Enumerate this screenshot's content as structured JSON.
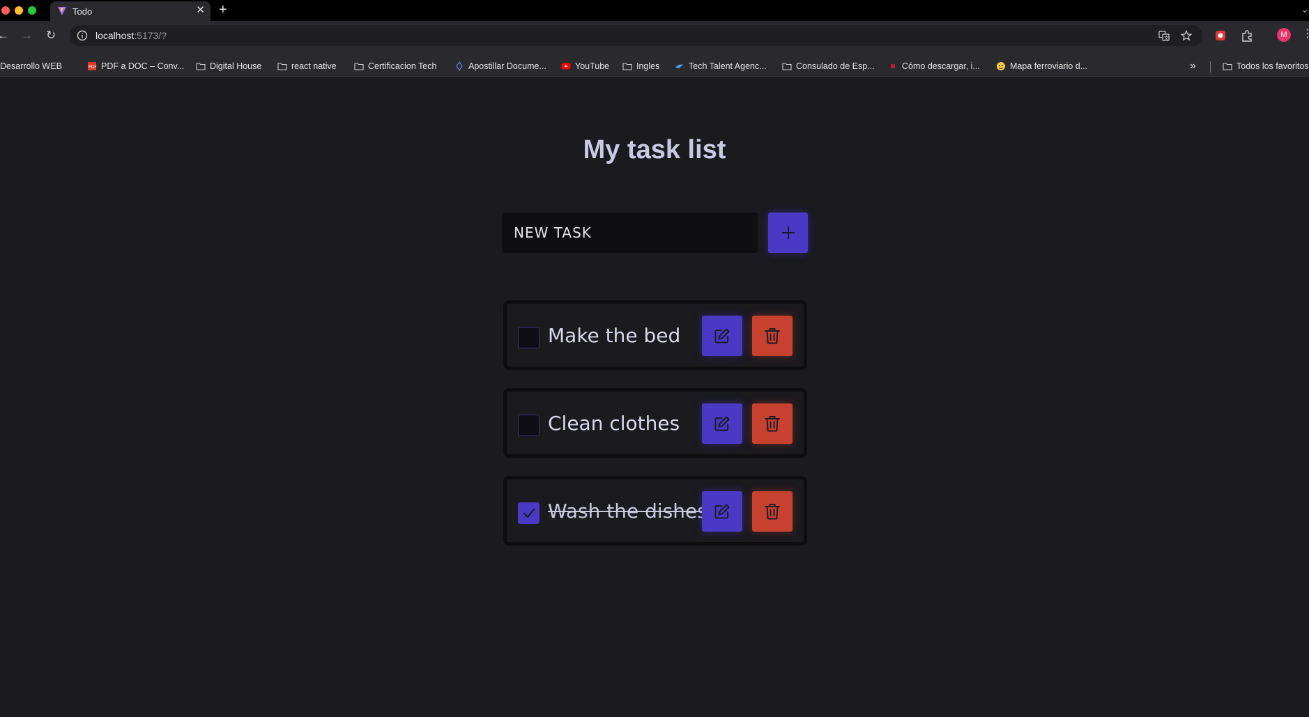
{
  "browser": {
    "tab_title": "Todo",
    "new_tab_symbol": "+",
    "url_host": "localhost",
    "url_rest": ":5173/?",
    "avatar_initial": "M",
    "bookmarks": [
      {
        "label": "Desarrollo WEB",
        "icon": "folder-icon"
      },
      {
        "label": "PDF a DOC – Conv...",
        "icon": "pdf-icon"
      },
      {
        "label": "Digital House",
        "icon": "folder-icon"
      },
      {
        "label": "react native",
        "icon": "folder-icon"
      },
      {
        "label": "Certificacion Tech",
        "icon": "folder-icon"
      },
      {
        "label": "Apostillar Docume...",
        "icon": "site-icon"
      },
      {
        "label": "YouTube",
        "icon": "youtube-icon"
      },
      {
        "label": "Ingles",
        "icon": "folder-icon"
      },
      {
        "label": "Tech Talent Agenc...",
        "icon": "site-icon"
      },
      {
        "label": "Consulado de Esp...",
        "icon": "folder-icon"
      },
      {
        "label": "Cómo descargar, i...",
        "icon": "site-icon"
      },
      {
        "label": "Mapa ferroviario d...",
        "icon": "site-icon"
      }
    ],
    "more_bookmarks": "»",
    "all_bookmarks": "Todos los favoritos"
  },
  "app": {
    "title": "My task list",
    "new_task_placeholder": "NEW TASK",
    "accent_color": "#4b38c4",
    "danger_color": "#c8412f",
    "tasks": [
      {
        "label": "Make the bed",
        "completed": false
      },
      {
        "label": "Clean clothes",
        "completed": false
      },
      {
        "label": "Wash the dishes",
        "completed": true
      }
    ]
  }
}
